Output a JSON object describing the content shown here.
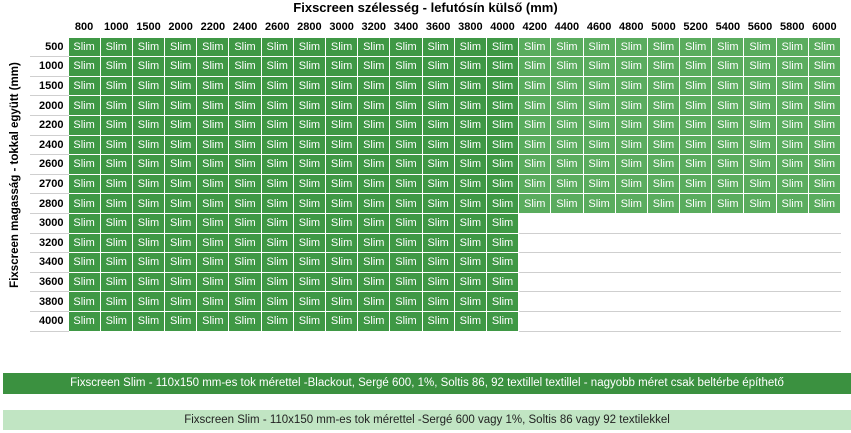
{
  "title": "Fixscreen szélesség - lefutósín külső (mm)",
  "y_label": "Fixscreen magasság - tokkal együtt (mm)",
  "cell_text": "Slim",
  "widths": [
    "800",
    "1000",
    "1500",
    "2000",
    "2200",
    "2400",
    "2600",
    "2800",
    "3000",
    "3200",
    "3400",
    "3600",
    "3800",
    "4000",
    "4200",
    "4400",
    "4600",
    "4800",
    "5000",
    "5200",
    "5400",
    "5600",
    "5800",
    "6000"
  ],
  "heights": [
    "500",
    "1000",
    "1500",
    "2000",
    "2200",
    "2400",
    "2600",
    "2700",
    "2800",
    "3000",
    "3200",
    "3400",
    "3600",
    "3800",
    "4000"
  ],
  "coverage": {
    "full_width_up_to_height": "2800",
    "max_width_above": "4000"
  },
  "legend": {
    "dark": "Fixscreen Slim - 110x150 mm-es tok mérettel -Blackout, Sergé 600, 1%, Soltis 86, 92  textillel textillel - nagyobb méret csak beltérbe építhető",
    "light": "Fixscreen Slim - 110x150 mm-es tok mérettel  -Sergé 600 vagy 1%, Soltis 86 vagy 92 textilekkel"
  },
  "colors": {
    "dark_green": "#3f9845",
    "medium_green": "#5aac5e",
    "light_green": "#c1e5c3"
  }
}
